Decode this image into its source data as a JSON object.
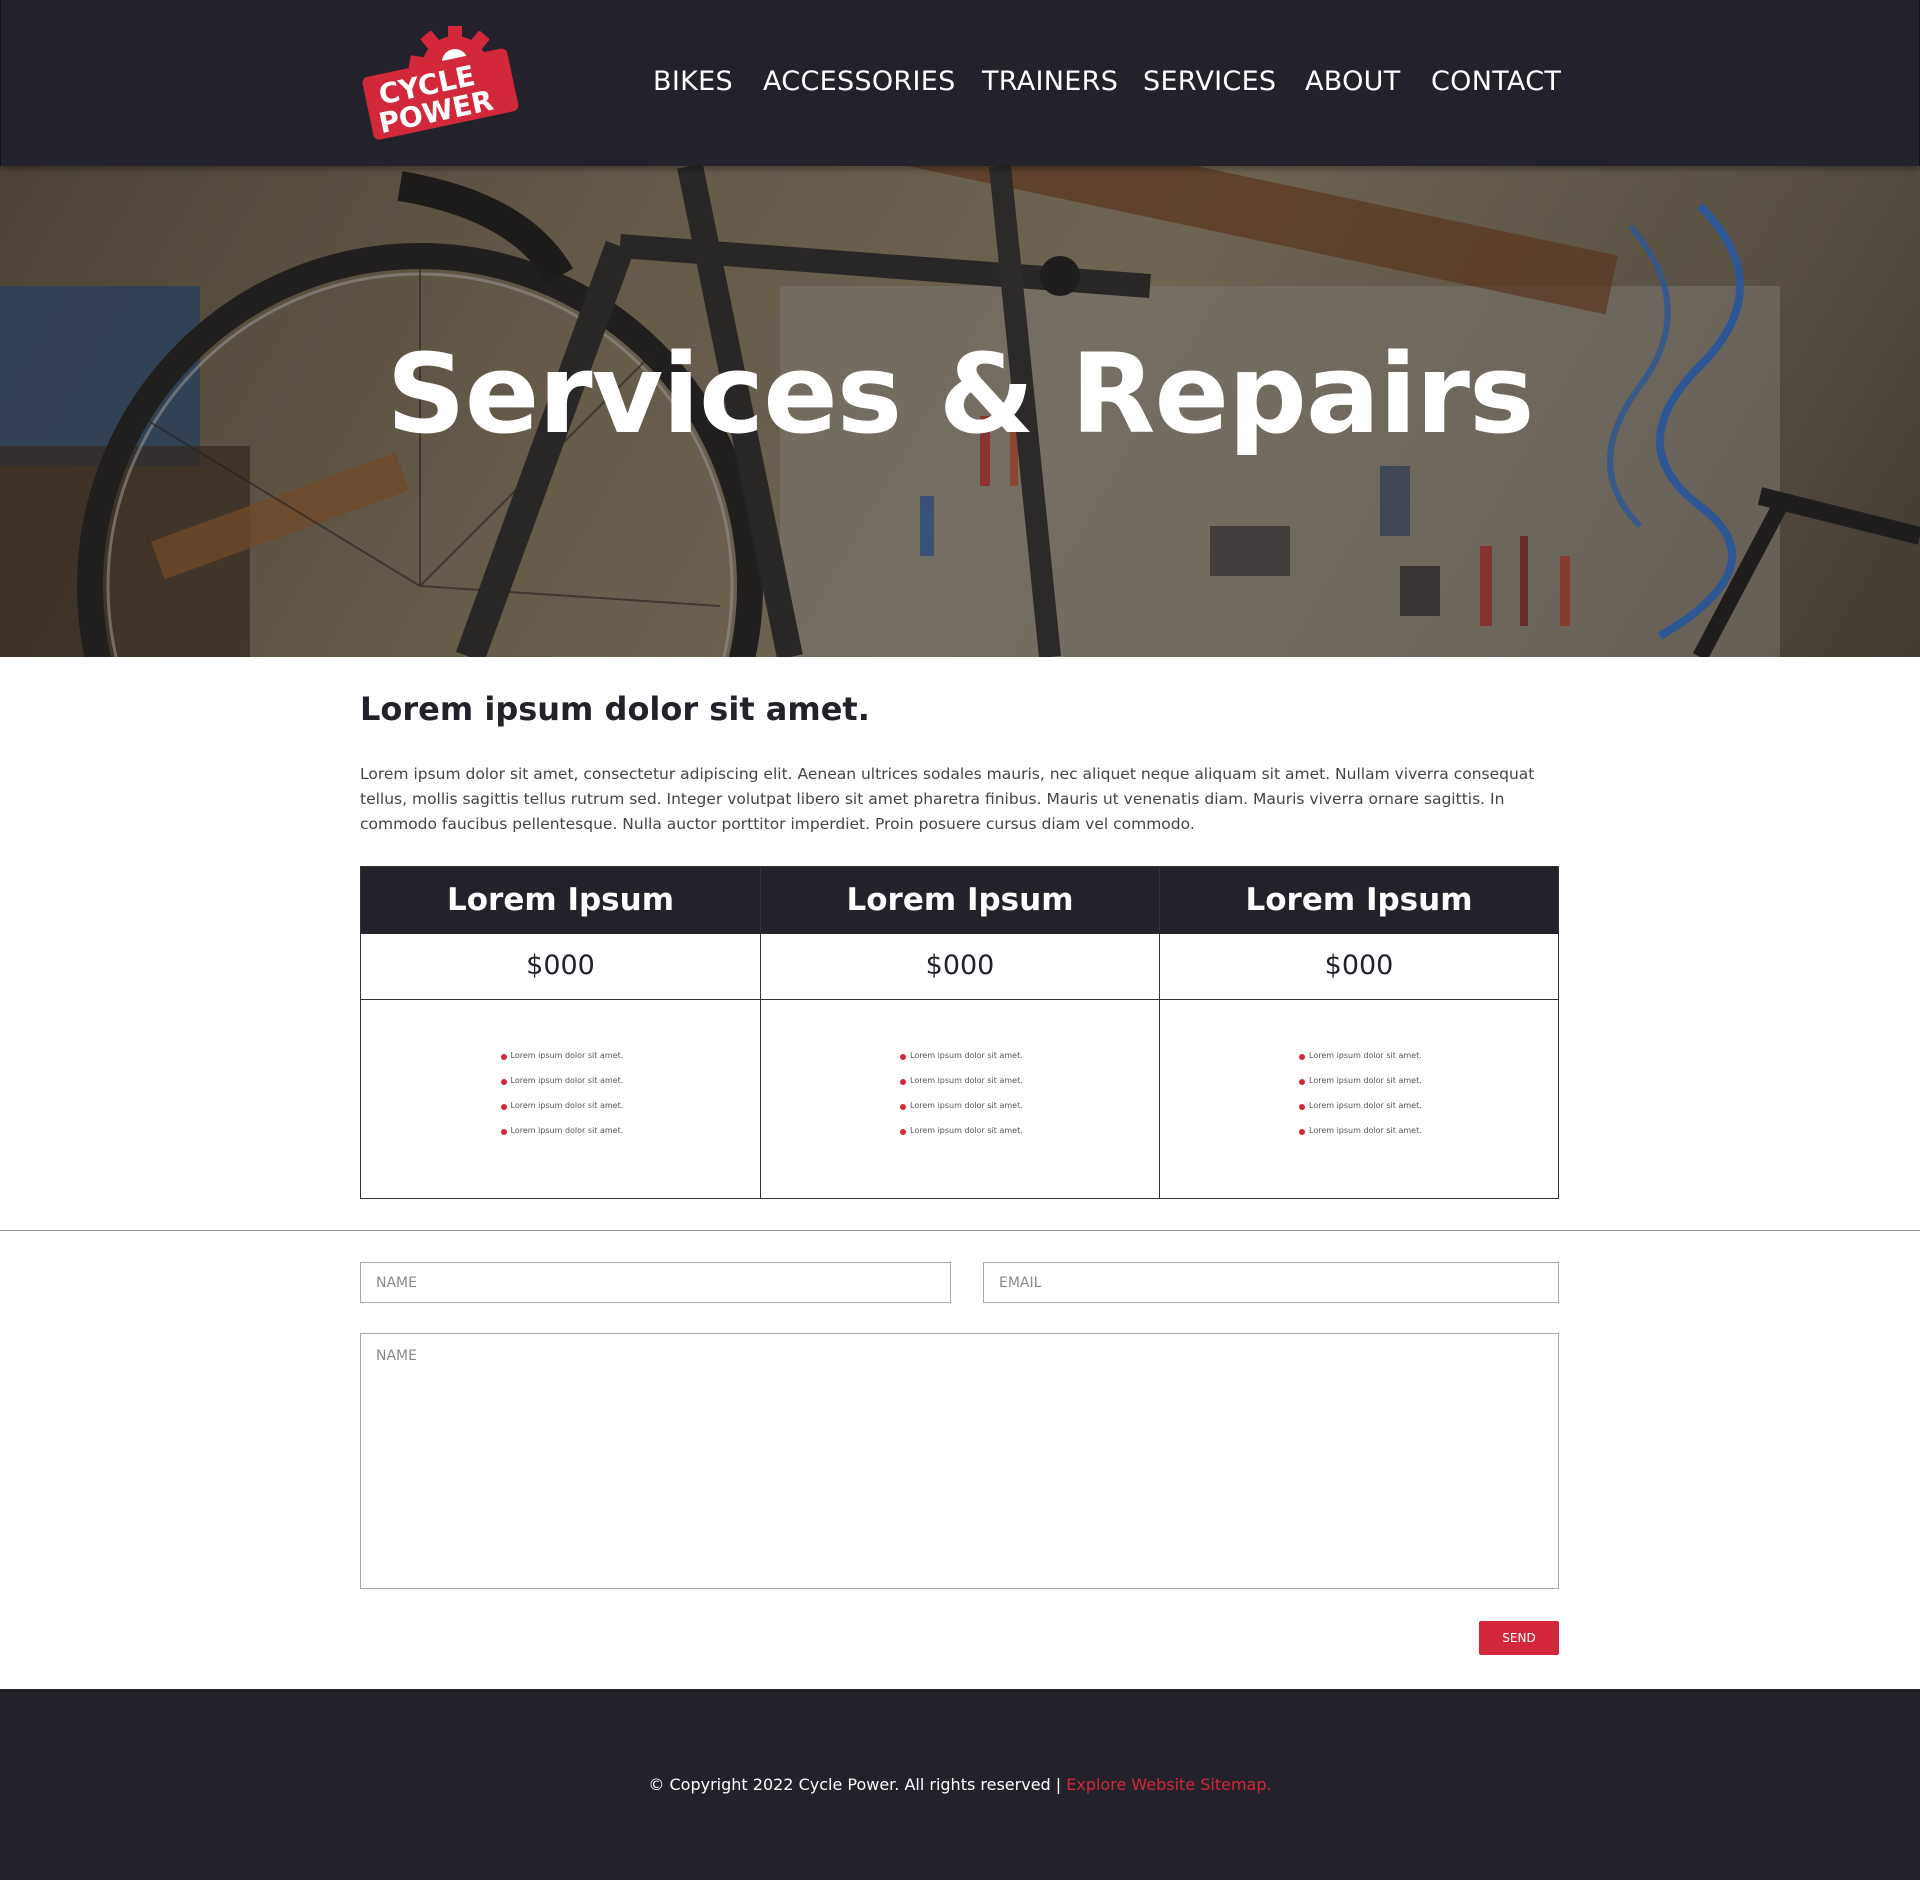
{
  "brand": {
    "logo_line1": "CYCLE",
    "logo_line2": "POWER",
    "accent_color": "#d3283a",
    "dark_color": "#23222b"
  },
  "nav": {
    "items": [
      {
        "label": "BIKES"
      },
      {
        "label": "ACCESSORIES"
      },
      {
        "label": "TRAINERS"
      },
      {
        "label": "SERVICES"
      },
      {
        "label": "ABOUT"
      },
      {
        "label": "CONTACT"
      }
    ]
  },
  "hero": {
    "title": "Services & Repairs"
  },
  "intro": {
    "heading": "Lorem ipsum dolor sit amet.",
    "text": "Lorem ipsum dolor sit amet, consectetur adipiscing elit. Aenean ultrices sodales mauris, nec aliquet neque aliquam sit amet. Nullam viverra consequat tellus, mollis sagittis tellus rutrum sed. Integer volutpat libero sit amet pharetra finibus. Mauris ut venenatis diam. Mauris viverra ornare sagittis. In commodo faucibus pellentesque. Nulla auctor porttitor imperdiet. Proin posuere cursus diam vel commodo."
  },
  "pricing": {
    "columns": [
      {
        "title": "Lorem Ipsum",
        "price": "$000",
        "features": [
          "Lorem ipsum dolor sit amet.",
          "Lorem ipsum dolor sit amet.",
          "Lorem ipsum dolor sit amet.",
          "Lorem ipsum dolor sit amet."
        ]
      },
      {
        "title": "Lorem Ipsum",
        "price": "$000",
        "features": [
          "Lorem ipsum dolor sit amet.",
          "Lorem ipsum dolor sit amet.",
          "Lorem ipsum dolor sit amet.",
          "Lorem ipsum dolor sit amet."
        ]
      },
      {
        "title": "Lorem Ipsum",
        "price": "$000",
        "features": [
          "Lorem ipsum dolor sit amet.",
          "Lorem ipsum dolor sit amet.",
          "Lorem ipsum dolor sit amet.",
          "Lorem ipsum dolor sit amet."
        ]
      }
    ]
  },
  "form": {
    "name_placeholder": "NAME",
    "email_placeholder": "EMAIL",
    "message_placeholder": "NAME",
    "send_label": "SEND"
  },
  "footer": {
    "copyright": "© Copyright 2022 Cycle Power. All rights reserved | ",
    "sitemap_link": "Explore Website Sitemap."
  }
}
